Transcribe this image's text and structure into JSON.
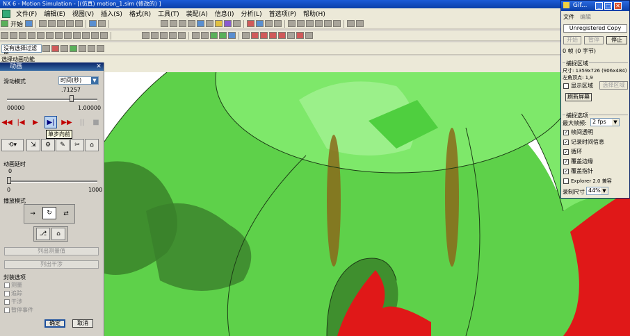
{
  "app": {
    "title": "NX 6 - Motion Simulation - [(仿真) motion_1.sim (修改的) ]",
    "menus": [
      "文件(F)",
      "编辑(E)",
      "视图(V)",
      "插入(S)",
      "格式(R)",
      "工具(T)",
      "装配(A)",
      "信息(I)",
      "分析(L)",
      "首选项(P)",
      "帮助(H)"
    ],
    "start_label": "开始",
    "filter_label": "没有选择过滤器",
    "status_text": "选择动画功能"
  },
  "anim_dialog": {
    "title": "动画",
    "slide_mode_label": "滑动模式",
    "slide_mode_value": "时间(秒)",
    "time_value": ".71257",
    "time_min": "00000",
    "time_max": "1.00000",
    "time_progress": 0.71257,
    "tooltip": "单步向前",
    "delay_label": "动画延时",
    "delay_value": "0",
    "delay_min": "0",
    "delay_max": "1000",
    "playback_label": "播放模式",
    "btn_list_measure": "列出测量值",
    "btn_list_interference": "列出干涉",
    "seal_label": "封装选项",
    "seal_options": [
      "测量",
      "追踪",
      "干涉",
      "暂停事件"
    ],
    "ok": "确定",
    "cancel": "取消"
  },
  "gif_window": {
    "title": "Gif...",
    "menu_file": "文件",
    "menu_edit": "编辑",
    "unregistered": "Unregistered Copy",
    "btn_start": "开始",
    "btn_pause": "暂停",
    "btn_stop": "停止",
    "frames": "0 帧 (0 字节)",
    "capture_area_label": "捕捉区域",
    "size_line": "尺寸: 1359x726 (906x484)",
    "origin_line": "左角顶点:   1,9",
    "show_area": "显示区域",
    "select_area": "选择区域",
    "refresh": "刷新屏幕",
    "capture_options_label": "捕捉选项",
    "max_fps_label": "最大帧频:",
    "max_fps_value": "2 fps",
    "options": [
      {
        "label": "帧间透明",
        "checked": true
      },
      {
        "label": "记录时间信息",
        "checked": true
      },
      {
        "label": "循环",
        "checked": true
      },
      {
        "label": "覆盖边缘",
        "checked": true
      },
      {
        "label": "覆盖指针",
        "checked": true
      },
      {
        "label": "Explorer 2.0 兼容",
        "checked": false
      }
    ],
    "record_size_label": "录制尺寸",
    "record_size_value": "44%"
  },
  "colors": {
    "green_light": "#7ee86a",
    "green_mid": "#5ed14a",
    "green_dark": "#3f8f2e",
    "red": "#e01818",
    "brown": "#8a6a1a"
  }
}
